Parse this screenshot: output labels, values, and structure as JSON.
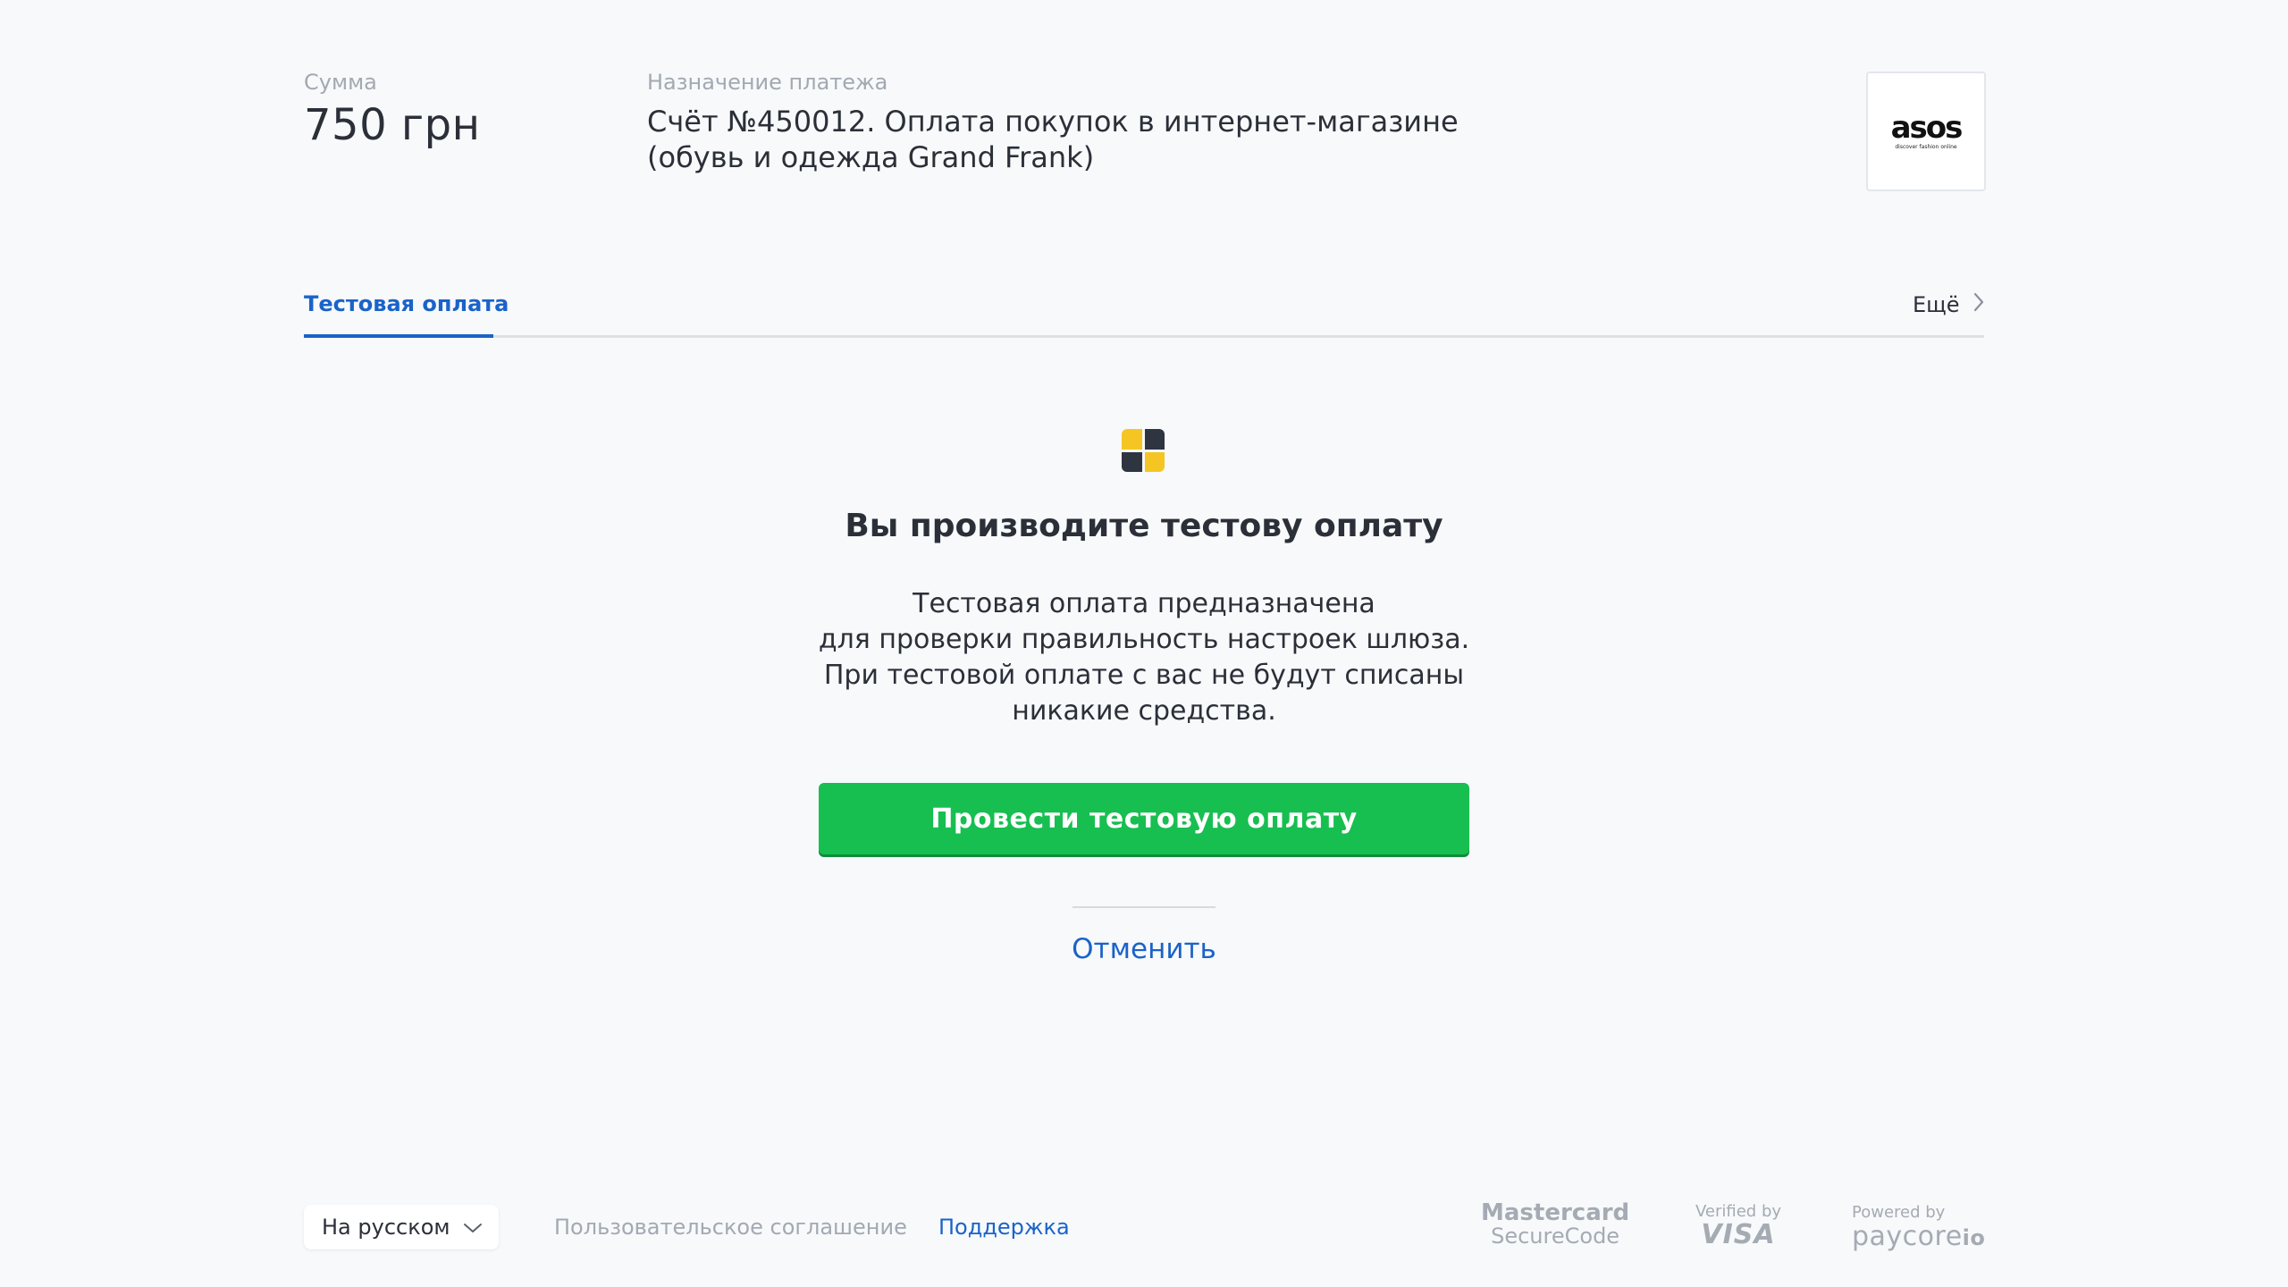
{
  "header": {
    "sum_label": "Сумма",
    "sum_value": "750 грн",
    "purpose_label": "Назначение платежа",
    "purpose_value": "Счёт №450012. Оплата покупок в интернет-магазине (обувь и одежда Grand Frank)",
    "merchant_logo": {
      "word": "asos",
      "subtitle": "discover fashion online"
    }
  },
  "tabs": {
    "active": "Тестовая оплата",
    "more": "Ещё"
  },
  "main": {
    "heading": "Вы производите тестову оплату",
    "description_lines": [
      "Тестовая оплата предназначена",
      "для проверки правильность настроек шлюза.",
      "При тестовой оплате с вас не будут списаны",
      "никакие средства."
    ],
    "primary_button": "Провести тестовую оплату",
    "cancel": "Отменить"
  },
  "footer": {
    "language": "На русском",
    "agreement": "Пользовательское соглашение",
    "support": "Поддержка",
    "badges": {
      "mastercard_line1": "Mastercard",
      "mastercard_line2": "SecureCode",
      "visa_line1": "Verified by",
      "visa_line2": "VISA",
      "paycore_line1": "Powered by",
      "paycore_line2": "paycore",
      "paycore_suffix": "io"
    }
  },
  "colors": {
    "accent": "#1a63c9",
    "primary_button": "#17bf50",
    "background": "#f7f9fb",
    "icon_yellow": "#f5c623",
    "icon_dark": "#2e3440"
  },
  "icons": [
    "test-payment-icon",
    "chevron-right-icon",
    "chevron-down-icon"
  ]
}
